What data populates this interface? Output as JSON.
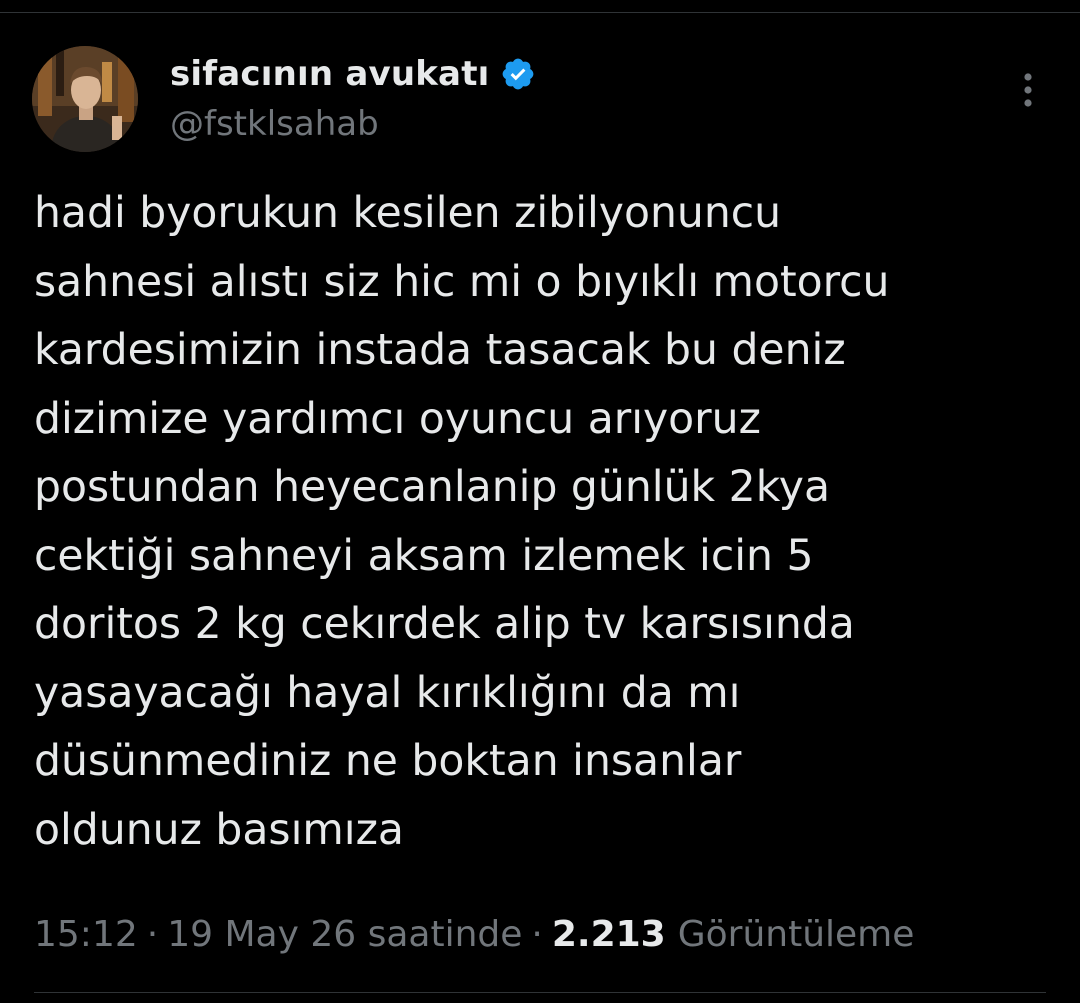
{
  "tweet": {
    "author": {
      "display_name": "sifacının avukatı",
      "handle": "@fstklsahab",
      "verified": true,
      "avatar_icon": "profile-photo"
    },
    "more_icon": "more-options-icon",
    "text": "hadi byorukun kesilen zibilyonuncu\nsahnesi alıstı siz hic mi o bıyıklı motorcu\nkardesimizin instada tasacak bu deniz\ndizimize yardımcı oyuncu arıyoruz\npostundan heyecanlanip günlük 2kya\ncektiği sahneyi aksam izlemek icin 5\ndoritos 2 kg cekırdek alip tv karsısında\nyasayacağı hayal kırıklığını da mı\ndüsünmediniz ne boktan insanlar\noldunuz basımıza",
    "meta": {
      "time": "15:12",
      "separator": "·",
      "date": "19 May 26 saatinde",
      "views_count": "2.213",
      "views_label": "Görüntüleme"
    }
  },
  "colors": {
    "background": "#000000",
    "text_primary": "#e7e9ea",
    "text_secondary": "#71767b",
    "verified_blue": "#1d9bf0",
    "divider": "#2f3336"
  }
}
